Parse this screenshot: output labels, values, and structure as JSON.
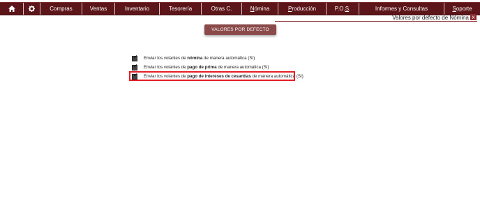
{
  "menu": {
    "home_icon": "home-icon",
    "settings_icon": "gear-icon",
    "items": [
      {
        "label": "Compras"
      },
      {
        "label": "Ventas"
      },
      {
        "label": "Inventario"
      },
      {
        "label": "Tesorería"
      },
      {
        "label": "Otras C."
      },
      {
        "pre": "",
        "under": "N",
        "post": "ómina"
      },
      {
        "pre": "",
        "under": "P",
        "post": "roducción"
      },
      {
        "pre": "P.O.",
        "under": "S",
        "post": "."
      },
      {
        "label": "Informes y Consultas"
      },
      {
        "pre": "",
        "under": "S",
        "post": "oporte"
      }
    ]
  },
  "panel": {
    "title": "Valores por defecto de Nómina",
    "close_label": "x"
  },
  "defaults_button": "VALORES POR DEFECTO",
  "options": [
    {
      "prefix": "Enviar los volantes de ",
      "bold": "nómina",
      "suffix": " de manera automática",
      "value": "(SI)",
      "checked": true
    },
    {
      "prefix": "Enviar los volantes de ",
      "bold": "pago de prima",
      "suffix": " de manera automática",
      "value": "(SI)",
      "checked": true
    },
    {
      "prefix": "Enviar los volantes de ",
      "bold": "pago de intereses de cesantías",
      "suffix": " de manera automática",
      "value": "(SI)",
      "checked": true,
      "highlighted": true
    }
  ],
  "colors": {
    "menubar": "#5c1519",
    "button": "#8a4a4a",
    "highlight": "#e41e25"
  }
}
